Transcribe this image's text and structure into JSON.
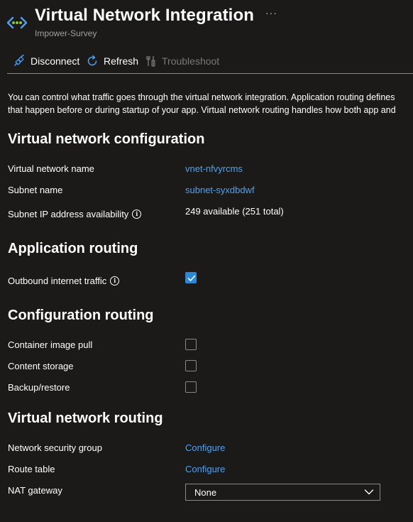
{
  "header": {
    "title": "Virtual Network Integration",
    "subtitle": "Impower-Survey",
    "more_label": "···"
  },
  "toolbar": {
    "disconnect_label": "Disconnect",
    "refresh_label": "Refresh",
    "troubleshoot_label": "Troubleshoot"
  },
  "description": {
    "line1": "You can control what traffic goes through the virtual network integration. Application routing defines",
    "line2": "that happen before or during startup of your app. Virtual network routing handles how both app and"
  },
  "vnet_config": {
    "title": "Virtual network configuration",
    "vnet_name_label": "Virtual network name",
    "vnet_name_value": "vnet-nfvyrcms",
    "subnet_name_label": "Subnet name",
    "subnet_name_value": "subnet-syxdbdwf",
    "subnet_ip_label": "Subnet IP address availability",
    "subnet_ip_value": "249 available (251 total)"
  },
  "app_routing": {
    "title": "Application routing",
    "outbound_label": "Outbound internet traffic",
    "outbound_checked": true
  },
  "config_routing": {
    "title": "Configuration routing",
    "container_label": "Container image pull",
    "container_checked": false,
    "content_label": "Content storage",
    "content_checked": false,
    "backup_label": "Backup/restore",
    "backup_checked": false
  },
  "vnet_routing": {
    "title": "Virtual network routing",
    "nsg_label": "Network security group",
    "nsg_value": "Configure",
    "route_label": "Route table",
    "route_value": "Configure",
    "nat_label": "NAT gateway",
    "nat_value": "None"
  },
  "colors": {
    "background": "#1b1a19",
    "link": "#4ea1f3",
    "accent": "#2b88d8"
  }
}
